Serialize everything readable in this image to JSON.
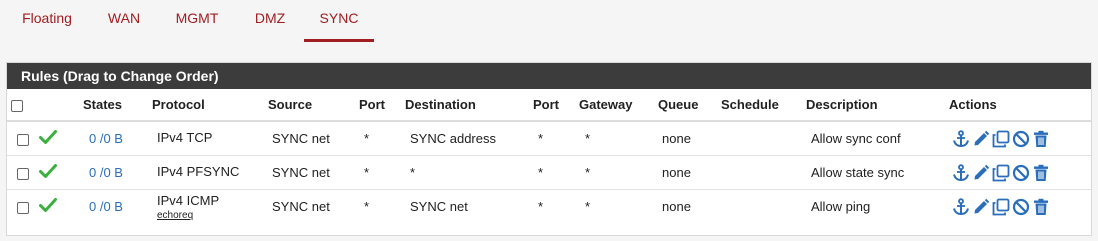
{
  "tabs": [
    {
      "label": "Floating"
    },
    {
      "label": "WAN"
    },
    {
      "label": "MGMT"
    },
    {
      "label": "DMZ"
    },
    {
      "label": "SYNC"
    }
  ],
  "panel": {
    "title": "Rules (Drag to Change Order)"
  },
  "columns": {
    "states": "States",
    "protocol": "Protocol",
    "source": "Source",
    "port": "Port",
    "destination": "Destination",
    "dport": "Port",
    "gateway": "Gateway",
    "queue": "Queue",
    "schedule": "Schedule",
    "description": "Description",
    "actions": "Actions"
  },
  "rows": [
    {
      "states": "0 /0 B",
      "protocol": "IPv4 TCP",
      "protocol_sub": "",
      "source": "SYNC net",
      "port": "*",
      "destination": "SYNC address",
      "dport": "*",
      "gateway": "*",
      "queue": "none",
      "schedule": "",
      "description": "Allow sync conf"
    },
    {
      "states": "0 /0 B",
      "protocol": "IPv4 PFSYNC",
      "protocol_sub": "",
      "source": "SYNC net",
      "port": "*",
      "destination": "*",
      "dport": "*",
      "gateway": "*",
      "queue": "none",
      "schedule": "",
      "description": "Allow state sync"
    },
    {
      "states": "0 /0 B",
      "protocol": "IPv4 ICMP",
      "protocol_sub": "echoreq",
      "source": "SYNC net",
      "port": "*",
      "destination": "SYNC net",
      "dport": "*",
      "gateway": "*",
      "queue": "none",
      "schedule": "",
      "description": "Allow ping"
    }
  ],
  "icons": {
    "enabled": "check-icon",
    "anchor": "anchor-icon",
    "edit": "pencil-icon",
    "copy": "copy-icon",
    "disable": "ban-icon",
    "delete": "trash-icon"
  },
  "colors": {
    "accent": "#a01d21",
    "header_bg": "#3c3c3c",
    "link": "#2a6ebb",
    "check": "#3ab03e",
    "action_icon": "#2a6ebb"
  }
}
